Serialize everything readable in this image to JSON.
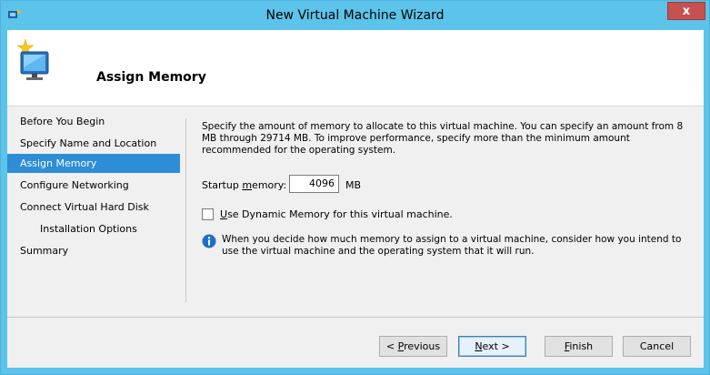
{
  "window": {
    "title": "New Virtual Machine Wizard",
    "close_glyph": "x"
  },
  "header": {
    "title": "Assign Memory"
  },
  "nav": {
    "items": [
      {
        "label": "Before You Begin"
      },
      {
        "label": "Specify Name and Location"
      },
      {
        "label": "Assign Memory",
        "selected": true
      },
      {
        "label": "Configure Networking"
      },
      {
        "label": "Connect Virtual Hard Disk"
      },
      {
        "label": "Installation Options"
      },
      {
        "label": "Summary"
      }
    ]
  },
  "content": {
    "description": "Specify the amount of memory to allocate to this virtual machine. You can specify an amount from 8 MB through 29714 MB. To improve performance, specify more than the minimum amount recommended for the operating system.",
    "startup_memory": {
      "label_pre": "Startup ",
      "label_mnemonic": "m",
      "label_post": "emory:",
      "value": "4096",
      "unit": "MB"
    },
    "dynamic_memory": {
      "checked": false,
      "label_mnemonic": "U",
      "label_post": "se Dynamic Memory for this virtual machine."
    },
    "info_text": "When you decide how much memory to assign to a virtual machine, consider how you intend to use the virtual machine and the operating system that it will run."
  },
  "buttons": {
    "previous": {
      "pre": "< ",
      "mnemonic": "P",
      "post": "revious"
    },
    "next": {
      "pre": "",
      "mnemonic": "N",
      "post": "ext >"
    },
    "finish": {
      "pre": "",
      "mnemonic": "F",
      "post": "inish"
    },
    "cancel": {
      "label": "Cancel"
    }
  },
  "colors": {
    "title_bar": "#5cc3ea",
    "selected_nav": "#2e8dd7",
    "close_button": "#c75050"
  }
}
